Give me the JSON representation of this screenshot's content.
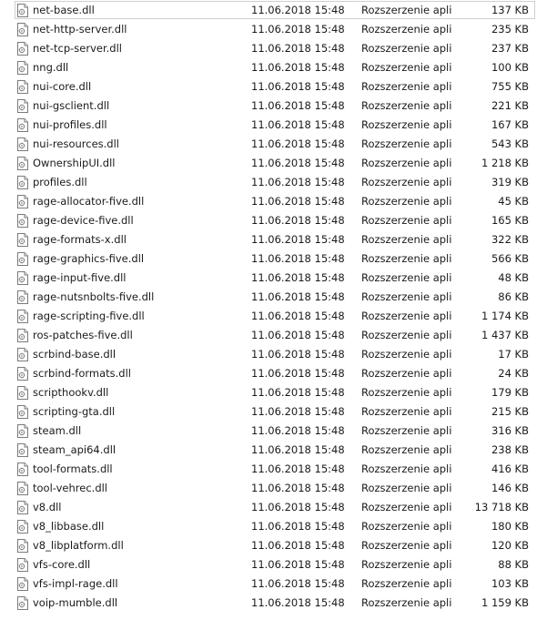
{
  "files": [
    {
      "name": "net-base.dll",
      "date": "11.06.2018 15:48",
      "type": "Rozszerzenie aplik...",
      "size": "137 KB",
      "selected": true
    },
    {
      "name": "net-http-server.dll",
      "date": "11.06.2018 15:48",
      "type": "Rozszerzenie aplik...",
      "size": "235 KB"
    },
    {
      "name": "net-tcp-server.dll",
      "date": "11.06.2018 15:48",
      "type": "Rozszerzenie aplik...",
      "size": "237 KB"
    },
    {
      "name": "nng.dll",
      "date": "11.06.2018 15:48",
      "type": "Rozszerzenie aplik...",
      "size": "100 KB"
    },
    {
      "name": "nui-core.dll",
      "date": "11.06.2018 15:48",
      "type": "Rozszerzenie aplik...",
      "size": "755 KB"
    },
    {
      "name": "nui-gsclient.dll",
      "date": "11.06.2018 15:48",
      "type": "Rozszerzenie aplik...",
      "size": "221 KB"
    },
    {
      "name": "nui-profiles.dll",
      "date": "11.06.2018 15:48",
      "type": "Rozszerzenie aplik...",
      "size": "167 KB"
    },
    {
      "name": "nui-resources.dll",
      "date": "11.06.2018 15:48",
      "type": "Rozszerzenie aplik...",
      "size": "543 KB"
    },
    {
      "name": "OwnershipUI.dll",
      "date": "11.06.2018 15:48",
      "type": "Rozszerzenie aplik...",
      "size": "1 218 KB"
    },
    {
      "name": "profiles.dll",
      "date": "11.06.2018 15:48",
      "type": "Rozszerzenie aplik...",
      "size": "319 KB"
    },
    {
      "name": "rage-allocator-five.dll",
      "date": "11.06.2018 15:48",
      "type": "Rozszerzenie aplik...",
      "size": "45 KB"
    },
    {
      "name": "rage-device-five.dll",
      "date": "11.06.2018 15:48",
      "type": "Rozszerzenie aplik...",
      "size": "165 KB"
    },
    {
      "name": "rage-formats-x.dll",
      "date": "11.06.2018 15:48",
      "type": "Rozszerzenie aplik...",
      "size": "322 KB"
    },
    {
      "name": "rage-graphics-five.dll",
      "date": "11.06.2018 15:48",
      "type": "Rozszerzenie aplik...",
      "size": "566 KB"
    },
    {
      "name": "rage-input-five.dll",
      "date": "11.06.2018 15:48",
      "type": "Rozszerzenie aplik...",
      "size": "48 KB"
    },
    {
      "name": "rage-nutsnbolts-five.dll",
      "date": "11.06.2018 15:48",
      "type": "Rozszerzenie aplik...",
      "size": "86 KB"
    },
    {
      "name": "rage-scripting-five.dll",
      "date": "11.06.2018 15:48",
      "type": "Rozszerzenie aplik...",
      "size": "1 174 KB"
    },
    {
      "name": "ros-patches-five.dll",
      "date": "11.06.2018 15:48",
      "type": "Rozszerzenie aplik...",
      "size": "1 437 KB"
    },
    {
      "name": "scrbind-base.dll",
      "date": "11.06.2018 15:48",
      "type": "Rozszerzenie aplik...",
      "size": "17 KB"
    },
    {
      "name": "scrbind-formats.dll",
      "date": "11.06.2018 15:48",
      "type": "Rozszerzenie aplik...",
      "size": "24 KB"
    },
    {
      "name": "scripthookv.dll",
      "date": "11.06.2018 15:48",
      "type": "Rozszerzenie aplik...",
      "size": "179 KB"
    },
    {
      "name": "scripting-gta.dll",
      "date": "11.06.2018 15:48",
      "type": "Rozszerzenie aplik...",
      "size": "215 KB"
    },
    {
      "name": "steam.dll",
      "date": "11.06.2018 15:48",
      "type": "Rozszerzenie aplik...",
      "size": "316 KB"
    },
    {
      "name": "steam_api64.dll",
      "date": "11.06.2018 15:48",
      "type": "Rozszerzenie aplik...",
      "size": "238 KB"
    },
    {
      "name": "tool-formats.dll",
      "date": "11.06.2018 15:48",
      "type": "Rozszerzenie aplik...",
      "size": "416 KB"
    },
    {
      "name": "tool-vehrec.dll",
      "date": "11.06.2018 15:48",
      "type": "Rozszerzenie aplik...",
      "size": "146 KB"
    },
    {
      "name": "v8.dll",
      "date": "11.06.2018 15:48",
      "type": "Rozszerzenie aplik...",
      "size": "13 718 KB"
    },
    {
      "name": "v8_libbase.dll",
      "date": "11.06.2018 15:48",
      "type": "Rozszerzenie aplik...",
      "size": "180 KB"
    },
    {
      "name": "v8_libplatform.dll",
      "date": "11.06.2018 15:48",
      "type": "Rozszerzenie aplik...",
      "size": "120 KB"
    },
    {
      "name": "vfs-core.dll",
      "date": "11.06.2018 15:48",
      "type": "Rozszerzenie aplik...",
      "size": "88 KB"
    },
    {
      "name": "vfs-impl-rage.dll",
      "date": "11.06.2018 15:48",
      "type": "Rozszerzenie aplik...",
      "size": "103 KB"
    },
    {
      "name": "voip-mumble.dll",
      "date": "11.06.2018 15:48",
      "type": "Rozszerzenie aplik...",
      "size": "1 159 KB"
    }
  ],
  "icon": "dll-file-icon",
  "colors": {
    "text": "#1a1a1a",
    "focus_border": "#d0d0d0"
  }
}
